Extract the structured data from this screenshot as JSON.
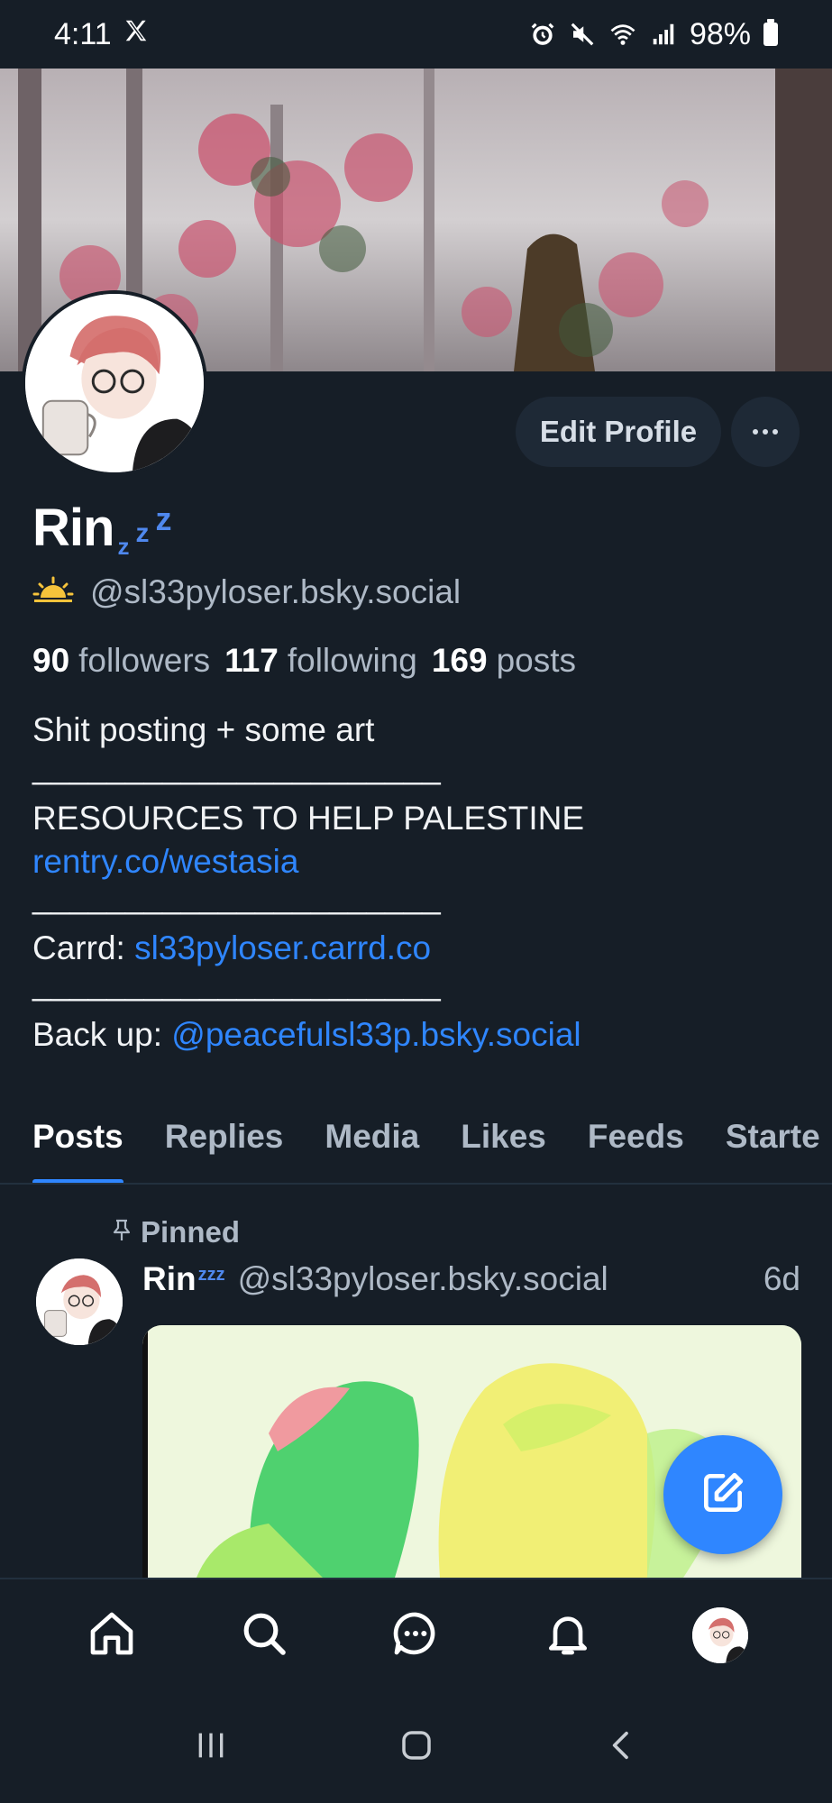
{
  "status_bar": {
    "time": "4:11",
    "battery": "98%",
    "icons": [
      "x-logo-icon",
      "alarm-icon",
      "mute-icon",
      "wifi-icon",
      "signal-icon",
      "battery-icon"
    ]
  },
  "profile": {
    "display_name": "Rin",
    "name_suffix": "zzz",
    "handle_icon": "sun-icon",
    "handle": "@sl33pyloser.bsky.social",
    "edit_label": "Edit Profile",
    "stats": {
      "followers_count": "90",
      "followers_label": "followers",
      "following_count": "117",
      "following_label": "following",
      "posts_count": "169",
      "posts_label": "posts"
    },
    "bio": {
      "line1": "Shit posting + some art",
      "divider": "______________________",
      "palestine_text": "RESOURCES TO HELP PALESTINE ",
      "palestine_link": "rentry.co/westasia",
      "carrd_text": "Carrd: ",
      "carrd_link": "sl33pyloser.carrd.co",
      "backup_text": "Back up: ",
      "backup_link": "@peacefulsl33p.bsky.social"
    }
  },
  "tabs": [
    {
      "label": "Posts",
      "active": true
    },
    {
      "label": "Replies",
      "active": false
    },
    {
      "label": "Media",
      "active": false
    },
    {
      "label": "Likes",
      "active": false
    },
    {
      "label": "Feeds",
      "active": false
    },
    {
      "label": "Starte",
      "active": false
    }
  ],
  "pinned_post": {
    "pinned_label": "Pinned",
    "author_name": "Rin",
    "author_suffix": "zzz",
    "author_handle": "@sl33pyloser.bsky.social",
    "time": "6d"
  },
  "bottom_nav": [
    "home-icon",
    "search-icon",
    "chat-icon",
    "bell-icon",
    "profile-avatar"
  ],
  "system_nav": [
    "recents-icon",
    "home-circle-icon",
    "back-icon"
  ],
  "colors": {
    "background": "#161e27",
    "accent": "#2f86ff",
    "muted_text": "#aeb9c6",
    "button_bg": "#1e2936"
  }
}
